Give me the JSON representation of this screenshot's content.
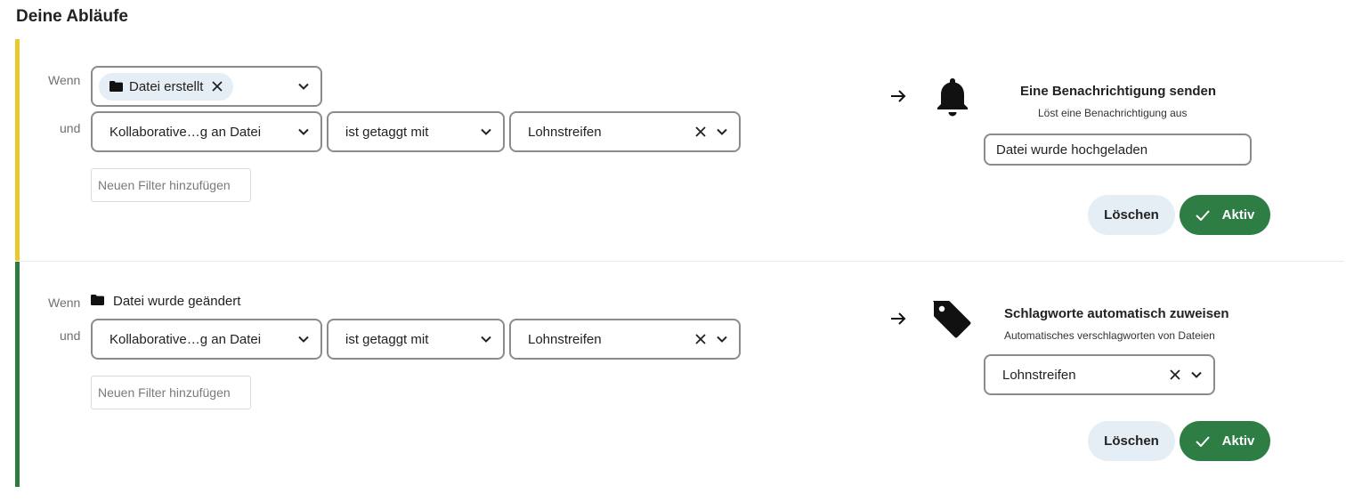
{
  "page": {
    "title": "Deine Abläufe"
  },
  "flows": [
    {
      "accent_color": "#e9c92f",
      "when_label": "Wenn",
      "and_label": "und",
      "trigger": {
        "chip_label": "Datei erstellt",
        "icon": "folder-icon"
      },
      "filter": {
        "attribute": "Kollaborative…g an Datei",
        "operator": "ist getaggt mit",
        "value": "Lohnstreifen"
      },
      "add_filter_placeholder": "Neuen Filter hinzufügen",
      "action": {
        "icon": "bell-icon",
        "title": "Eine Benachrichtigung senden",
        "description": "Löst eine Benachrichtigung aus",
        "input_value": "Datei wurde hochgeladen"
      },
      "delete_label": "Löschen",
      "active_label": "Aktiv"
    },
    {
      "accent_color": "#2d7b3f",
      "when_label": "Wenn",
      "and_label": "und",
      "trigger": {
        "label": "Datei wurde geändert",
        "icon": "folder-icon"
      },
      "filter": {
        "attribute": "Kollaborative…g an Datei",
        "operator": "ist getaggt mit",
        "value": "Lohnstreifen"
      },
      "add_filter_placeholder": "Neuen Filter hinzufügen",
      "action": {
        "icon": "tag-icon",
        "title": "Schlagworte automatisch zuweisen",
        "description": "Automatisches verschlagworten von Dateien",
        "select_value": "Lohnstreifen"
      },
      "delete_label": "Löschen",
      "active_label": "Aktiv"
    }
  ]
}
